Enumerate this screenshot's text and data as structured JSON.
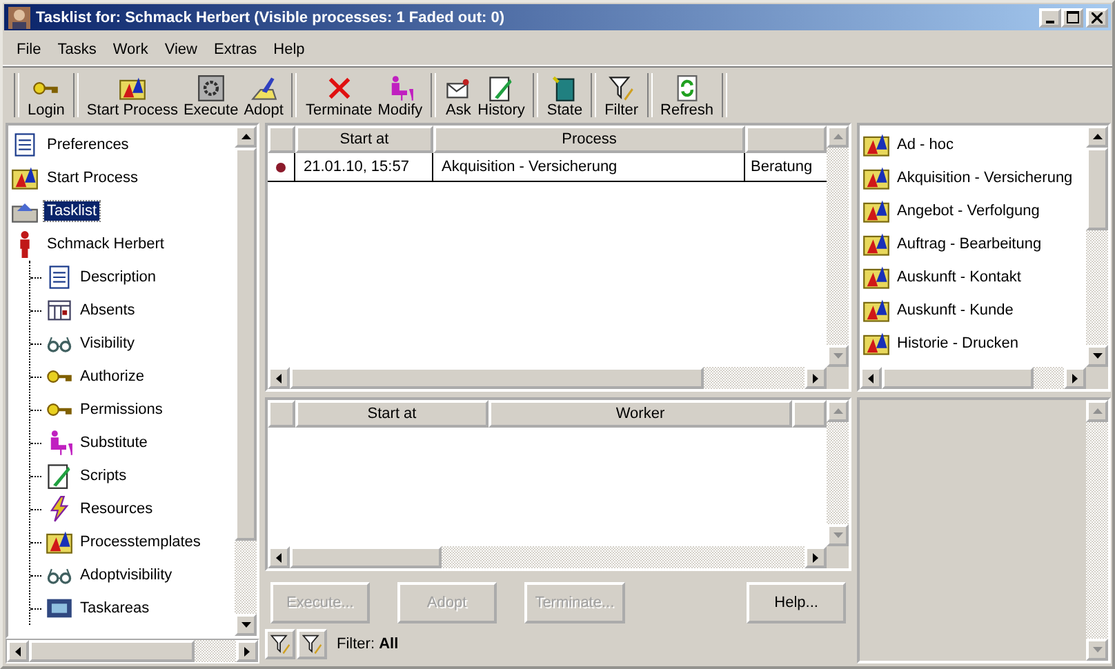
{
  "window": {
    "title": "Tasklist for: Schmack Herbert (Visible processes: 1 Faded out: 0)"
  },
  "menu": [
    "File",
    "Tasks",
    "Work",
    "View",
    "Extras",
    "Help"
  ],
  "toolbar": [
    [
      "Login"
    ],
    [
      "Start Process",
      "Execute",
      "Adopt"
    ],
    [
      "Terminate",
      "Modify"
    ],
    [
      "Ask",
      "History"
    ],
    [
      "State"
    ],
    [
      "Filter"
    ],
    [
      "Refresh"
    ]
  ],
  "tree": [
    {
      "label": "Preferences",
      "selected": false
    },
    {
      "label": "Start Process",
      "selected": false
    },
    {
      "label": "Tasklist",
      "selected": true
    },
    {
      "label": "Schmack Herbert",
      "selected": false,
      "children": [
        {
          "label": "Description",
          "selected": false
        },
        {
          "label": "Absents",
          "selected": false
        },
        {
          "label": "Visibility",
          "selected": false
        },
        {
          "label": "Authorize",
          "selected": false
        },
        {
          "label": "Permissions",
          "selected": false
        },
        {
          "label": "Substitute",
          "selected": false
        },
        {
          "label": "Scripts",
          "selected": false
        },
        {
          "label": "Resources",
          "selected": false
        },
        {
          "label": "Processtemplates",
          "selected": false
        },
        {
          "label": "Adoptvisibility",
          "selected": false
        },
        {
          "label": "Taskareas",
          "selected": false
        }
      ]
    }
  ],
  "process_table": {
    "columns": [
      "Start at",
      "Process"
    ],
    "rows": [
      {
        "color": "#8b1a2b",
        "cells": [
          "21.01.10, 15:57",
          "Akquisition - Versicherung",
          "Beratung"
        ]
      }
    ]
  },
  "worker_table": {
    "columns": [
      "Start at",
      "Worker"
    ]
  },
  "templates": [
    "Ad - hoc",
    "Akquisition - Versicherung",
    "Angebot - Verfolgung",
    "Auftrag - Bearbeitung",
    "Auskunft - Kontakt",
    "Auskunft - Kunde",
    "Historie - Drucken"
  ],
  "buttons": [
    {
      "label": "Execute...",
      "disabled": true
    },
    {
      "label": "Adopt",
      "disabled": true
    },
    {
      "label": "Terminate...",
      "disabled": true
    },
    {
      "label": "Help...",
      "disabled": false
    }
  ],
  "filter": "Filter: **All**"
}
